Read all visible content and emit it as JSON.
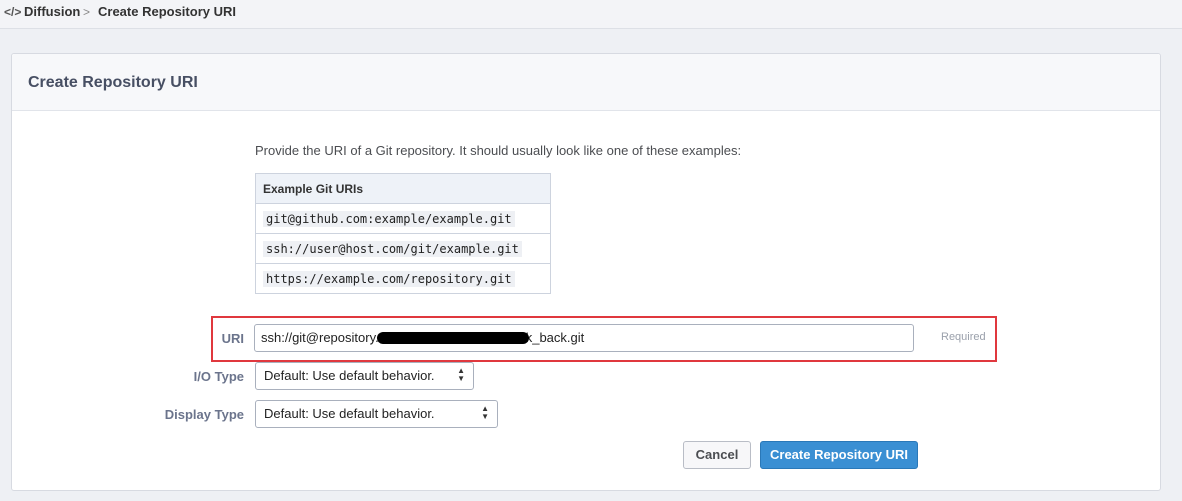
{
  "breadcrumb": {
    "app_icon": "code-icon",
    "app_icon_glyph": "</>",
    "app": "Diffusion",
    "separator": ">",
    "page": "Create Repository URI"
  },
  "panel": {
    "title": "Create Repository URI",
    "intro": "Provide the URI of a Git repository. It should usually look like one of these examples:",
    "examples": {
      "header": "Example Git URIs",
      "rows": [
        "git@github.com:example/example.git",
        "ssh://user@host.com/git/example.git",
        "https://example.com/repository.git"
      ]
    }
  },
  "form": {
    "uri": {
      "label": "URI",
      "value_prefix": "ssh://git@repository.",
      "value_suffix": "k_back.git",
      "required_note": "Required"
    },
    "io_type": {
      "label": "I/O Type",
      "selected": "Default: Use default behavior."
    },
    "display_type": {
      "label": "Display Type",
      "selected": "Default: Use default behavior."
    },
    "buttons": {
      "cancel": "Cancel",
      "submit": "Create Repository URI"
    }
  },
  "colors": {
    "primary_button": "#3a8fd3",
    "highlight_border": "#e0383e"
  }
}
